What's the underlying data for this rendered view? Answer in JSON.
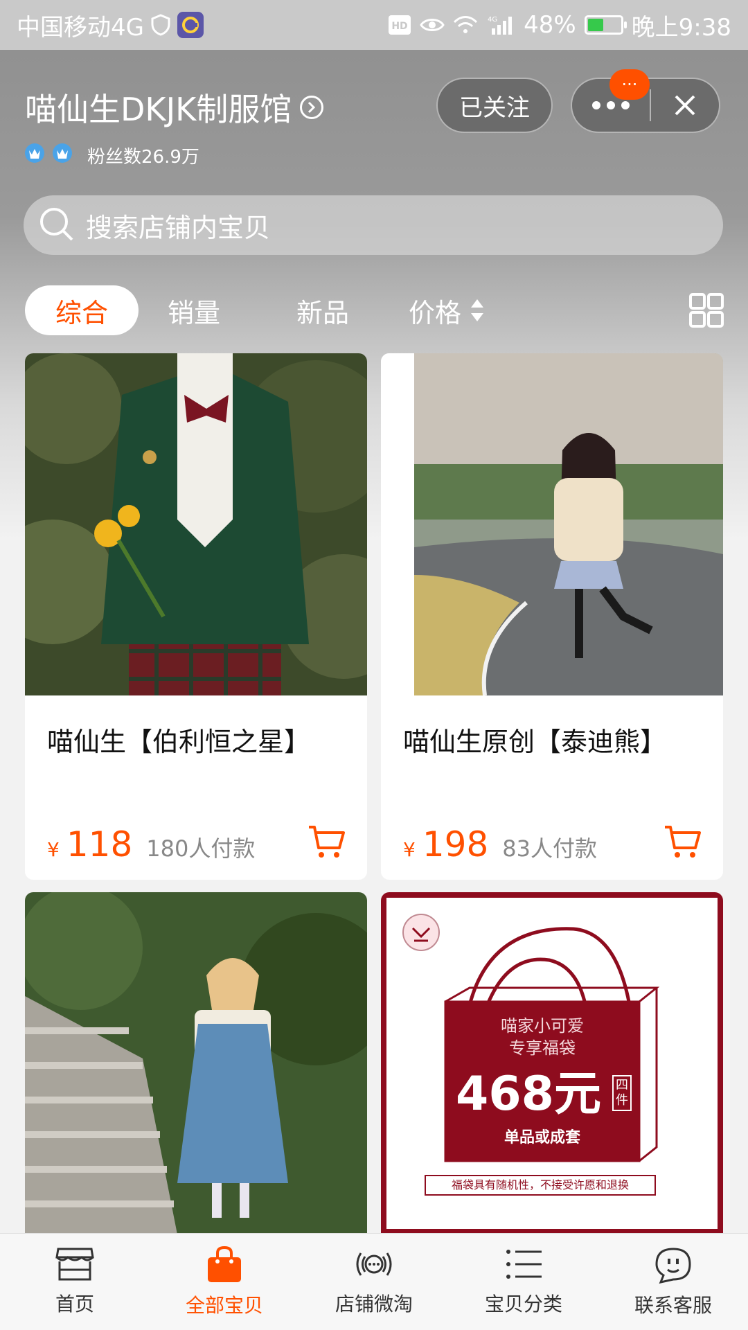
{
  "status_bar": {
    "carrier": "中国移动4G",
    "battery": "48%",
    "battery_level": 0.48,
    "time": "晚上9:38",
    "icons": [
      "shield-icon",
      "app-icon",
      "hd-icon",
      "eye-icon",
      "wifi-icon",
      "signal-4g-icon",
      "battery-icon"
    ]
  },
  "shop": {
    "name": "喵仙生DKJK制服馆",
    "fans": "粉丝数26.9万",
    "follow_label": "已关注",
    "msg_badge": "···"
  },
  "search": {
    "placeholder": "搜索店铺内宝贝"
  },
  "tabs": [
    {
      "label": "综合",
      "active": true
    },
    {
      "label": "销量",
      "active": false
    },
    {
      "label": "新品",
      "active": false
    },
    {
      "label": "价格",
      "active": false
    }
  ],
  "products": [
    {
      "title": "喵仙生【伯利恒之星】",
      "currency": "¥",
      "price": "118",
      "paid": "180人付款"
    },
    {
      "title": "喵仙生原创【泰迪熊】",
      "currency": "¥",
      "price": "198",
      "paid": "83人付款"
    },
    {
      "title": "",
      "currency": "",
      "price": "",
      "paid": ""
    },
    {
      "title": "",
      "currency": "",
      "price": "",
      "paid": "",
      "banner": {
        "line1": "喵家小可爱",
        "line2": "专享福袋",
        "amount": "468元",
        "tag": "四件",
        "line3": "单品或成套",
        "notice": "福袋具有随机性，不接受许愿和退换"
      }
    }
  ],
  "bottom_nav": [
    {
      "label": "首页",
      "icon": "store-icon",
      "active": false
    },
    {
      "label": "全部宝贝",
      "icon": "shopping-bag-icon",
      "active": true
    },
    {
      "label": "店铺微淘",
      "icon": "broadcast-icon",
      "active": false
    },
    {
      "label": "宝贝分类",
      "icon": "list-icon",
      "active": false
    },
    {
      "label": "联系客服",
      "icon": "chat-icon",
      "active": false
    }
  ],
  "colors": {
    "accent": "#ff5000",
    "banner_red": "#8e0c1e"
  }
}
